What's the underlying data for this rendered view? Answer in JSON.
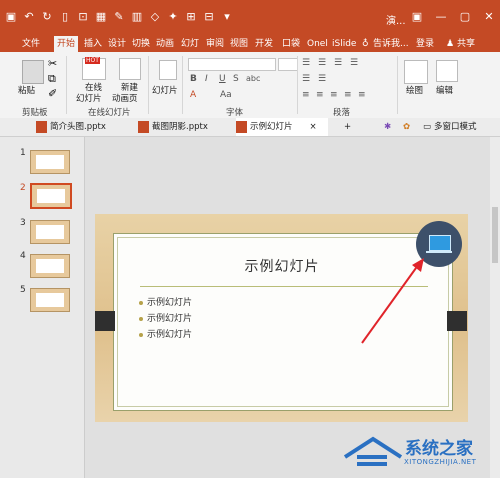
{
  "title_bar": {
    "qat_icons": [
      "save-icon",
      "undo-icon",
      "redo-icon",
      "new-icon",
      "start-icon",
      "format-icon",
      "pen-icon",
      "color-icon",
      "shape-icon",
      "brush-icon",
      "insert-icon",
      "grid-icon",
      "dropdown-icon"
    ],
    "doc_title": "演...",
    "window_buttons": [
      "restore-icon",
      "minimize-icon",
      "maximize-icon",
      "close-icon"
    ]
  },
  "tabs": {
    "file": "文件",
    "home": "开始",
    "insert": "插入",
    "design": "设计",
    "transitions": "切换",
    "animations": "动画",
    "slideshow": "幻灯",
    "review": "审阅",
    "view": "视图",
    "developer": "开发",
    "pocket": "口袋",
    "onenote": "Onel",
    "islide": "iSlide",
    "tellme": "告诉我...",
    "login": "登录",
    "share": "共享"
  },
  "ribbon": {
    "paste": "粘贴",
    "clipboard_group": "剪贴板",
    "online_slides_l1": "在线",
    "online_slides_l2": "幻灯片",
    "new_slide_l1": "新建",
    "new_slide_l2": "动画页",
    "online_group": "在线幻灯片",
    "slides_btn": "幻灯片",
    "font_group": "字体",
    "para_group": "段落",
    "drawing": "绘图",
    "editing": "编辑",
    "hot_badge": "HOT",
    "fmt_bold": "B",
    "fmt_italic": "I",
    "fmt_underline": "U",
    "fmt_strike": "S",
    "fmt_abc": "abc",
    "fmt_aa": "Aa",
    "fmt_color": "A"
  },
  "doc_tabs": [
    {
      "label": "简介头图.pptx",
      "active": false
    },
    {
      "label": "截图阴影.pptx",
      "active": false
    },
    {
      "label": "示例幻灯片",
      "active": true,
      "close": "×"
    },
    {
      "label": "+",
      "active": false
    }
  ],
  "doc_tab_right": {
    "multi_window": "多窗口模式"
  },
  "slides": {
    "numbers": [
      "1",
      "2",
      "3",
      "4",
      "5"
    ],
    "selected": 2
  },
  "slide": {
    "title": "示例幻灯片",
    "bullets": [
      "示例幻灯片",
      "示例幻灯片",
      "示例幻灯片"
    ]
  },
  "watermark": {
    "name": "系统之家",
    "url": "XITONGZHIJIA.NET"
  },
  "colors": {
    "accent": "#c44a25",
    "badge": "#3d506a",
    "arrow": "#e0242a"
  }
}
